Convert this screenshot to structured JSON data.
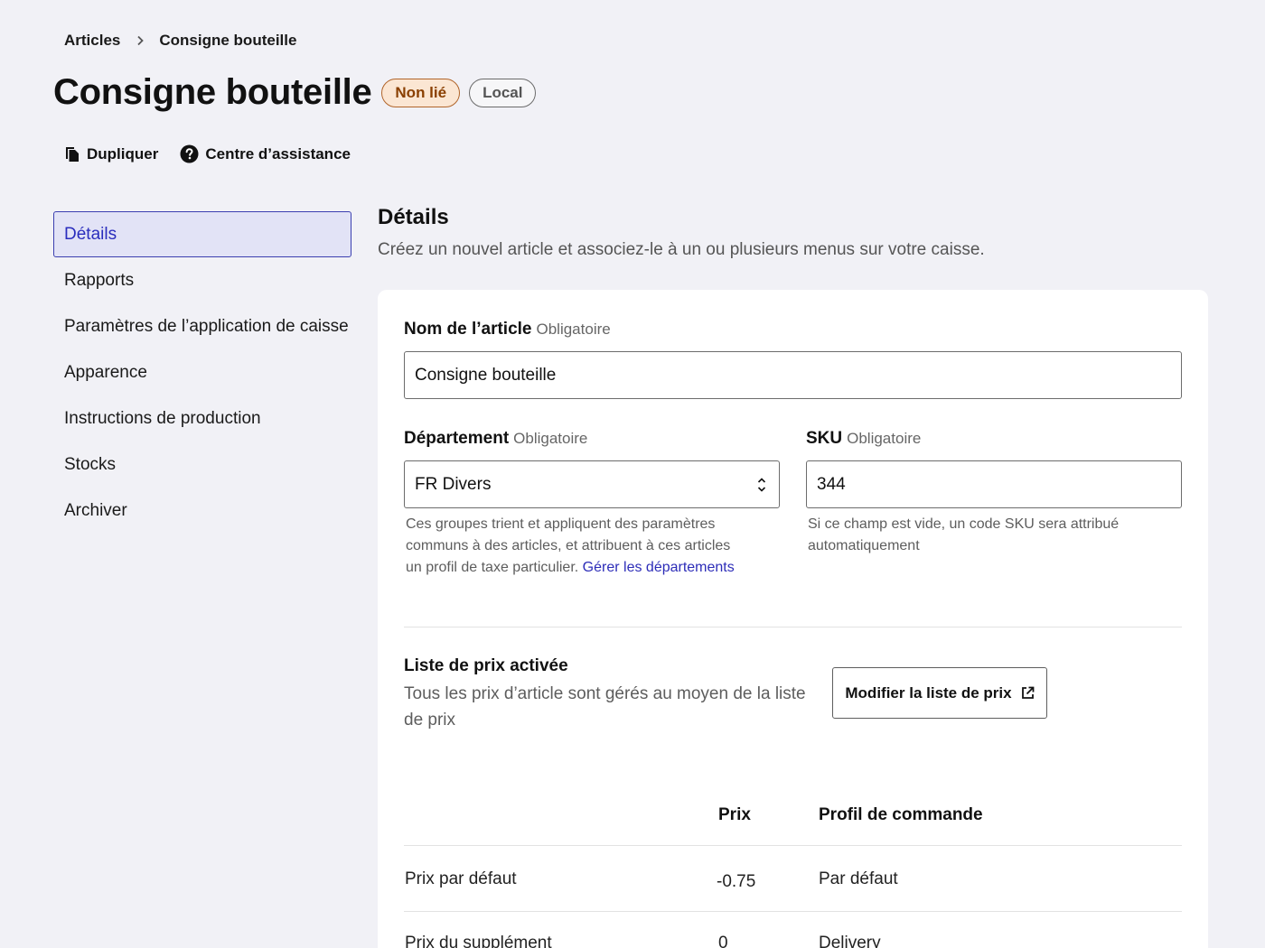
{
  "breadcrumb": {
    "parent": "Articles",
    "current": "Consigne bouteille"
  },
  "header": {
    "title": "Consigne bouteille",
    "badges": {
      "status": "Non lié",
      "scope": "Local"
    },
    "actions": {
      "duplicate": "Dupliquer",
      "help_center": "Centre d’assistance"
    }
  },
  "sidebar": {
    "items": [
      {
        "label": "Détails",
        "active": true
      },
      {
        "label": "Rapports"
      },
      {
        "label": "Paramètres de l’application de caisse"
      },
      {
        "label": "Apparence"
      },
      {
        "label": "Instructions de production"
      },
      {
        "label": "Stocks"
      },
      {
        "label": "Archiver"
      }
    ]
  },
  "section": {
    "title": "Détails",
    "description": "Créez un nouvel article et associez-le à un ou plusieurs menus sur votre caisse."
  },
  "form": {
    "required_text": "Obligatoire",
    "name": {
      "label": "Nom de l’article",
      "value": "Consigne bouteille"
    },
    "department": {
      "label": "Département",
      "value": "FR Divers",
      "help": "Ces groupes trient et appliquent des paramètres communs à des articles, et attribuent à ces articles un profil de taxe particulier.",
      "help_link": "Gérer les départements"
    },
    "sku": {
      "label": "SKU",
      "value": "344",
      "help": "Si ce champ est vide, un code SKU sera attribué automatiquement"
    }
  },
  "price_list": {
    "title": "Liste de prix activée",
    "description": "Tous les prix d’article sont gérés au moyen de la liste de prix",
    "button": "Modifier la liste de prix",
    "table": {
      "headers": {
        "price": "Prix",
        "profile": "Profil de commande"
      },
      "rows": [
        {
          "label": "Prix par défaut",
          "price": "-0.75",
          "profile": "Par défaut"
        },
        {
          "label": "Prix du supplément",
          "price": "0",
          "profile": "Delivery"
        }
      ]
    }
  },
  "icons": {
    "breadcrumb_sep": "chevron-right-icon",
    "duplicate": "copy-icon",
    "help": "question-circle-icon",
    "select": "chevron-up-down-icon",
    "external": "external-link-icon"
  },
  "colors": {
    "background": "#f1f1f6",
    "accent": "#2a2dbd",
    "badge_warn_bg": "#fbe6d3",
    "badge_warn_text": "#8a3f00"
  }
}
